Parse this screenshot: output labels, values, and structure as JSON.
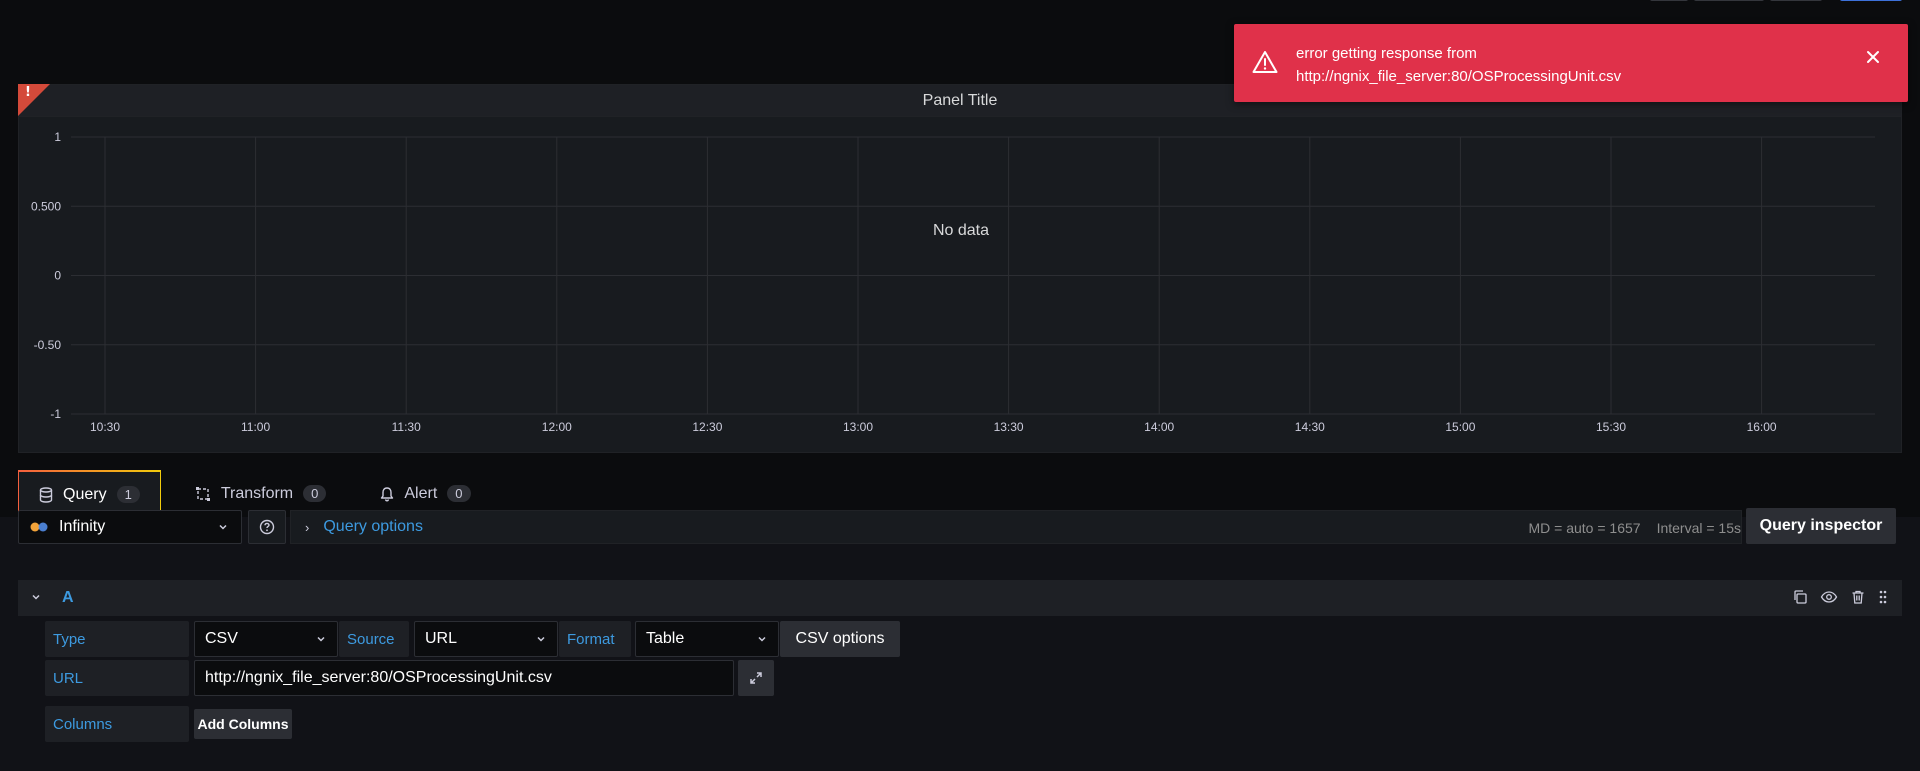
{
  "toast": {
    "line1": "error getting response from",
    "line2": "http://ngnix_file_server:80/OSProcessingUnit.csv",
    "close_icon": "close-icon",
    "warning_icon": "warning-icon",
    "color": "#e0314a"
  },
  "panel": {
    "title": "Panel Title",
    "error_mark": "!"
  },
  "chart_data": {
    "type": "line",
    "title": "Panel Title",
    "x": [
      "10:30",
      "11:00",
      "11:30",
      "12:00",
      "12:30",
      "13:00",
      "13:30",
      "14:00",
      "14:30",
      "15:00",
      "15:30",
      "16:00"
    ],
    "y_ticks": [
      "1",
      "0.500",
      "0",
      "-0.50",
      "-1"
    ],
    "y_values": [
      1,
      0.5,
      0,
      -0.5,
      -1
    ],
    "ylim": [
      -1,
      1
    ],
    "series": [],
    "no_data_text": "No data",
    "grid": true
  },
  "tabs": [
    {
      "label": "Query",
      "count": "1",
      "icon": "database-icon"
    },
    {
      "label": "Transform",
      "count": "0",
      "icon": "transform-icon"
    },
    {
      "label": "Alert",
      "count": "0",
      "icon": "bell-icon"
    }
  ],
  "query_header": {
    "datasource": "Infinity",
    "query_options_label": "Query options",
    "md": "MD = auto = 1657",
    "interval": "Interval = 15s",
    "inspector_label": "Query inspector"
  },
  "query": {
    "ref_id": "A",
    "type_label": "Type",
    "type_value": "CSV",
    "source_label": "Source",
    "source_value": "URL",
    "format_label": "Format",
    "format_value": "Table",
    "csv_options_label": "CSV options",
    "url_label": "URL",
    "url_value": "http://ngnix_file_server:80/OSProcessingUnit.csv",
    "columns_label": "Columns",
    "add_columns_label": "Add Columns"
  }
}
